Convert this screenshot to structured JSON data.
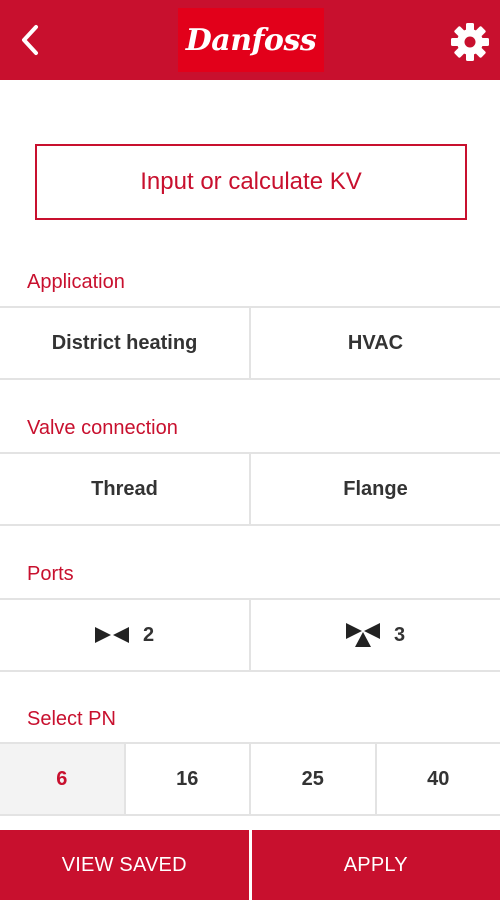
{
  "header": {
    "back_icon": "chevron-left-icon",
    "logo_text": "Danfoss",
    "settings_icon": "gear-icon"
  },
  "kv_button_label": "Input or calculate KV",
  "sections": {
    "application": {
      "title": "Application",
      "options": [
        "District heating",
        "HVAC"
      ]
    },
    "valve_connection": {
      "title": "Valve connection",
      "options": [
        "Thread",
        "Flange"
      ]
    },
    "ports": {
      "title": "Ports",
      "options": [
        {
          "icon": "two-way-valve-icon",
          "label": "2"
        },
        {
          "icon": "three-way-valve-icon",
          "label": "3"
        }
      ]
    },
    "pn": {
      "title": "Select PN",
      "options": [
        "6",
        "16",
        "25",
        "40"
      ],
      "selected": "6"
    }
  },
  "footer": {
    "view_saved_label": "VIEW SAVED",
    "apply_label": "APPLY"
  },
  "colors": {
    "brand_red": "#c8102e",
    "logo_red": "#e2001a",
    "divider": "#e3e3e3",
    "selected_bg": "#f3f3f3",
    "text_dark": "#333333"
  }
}
